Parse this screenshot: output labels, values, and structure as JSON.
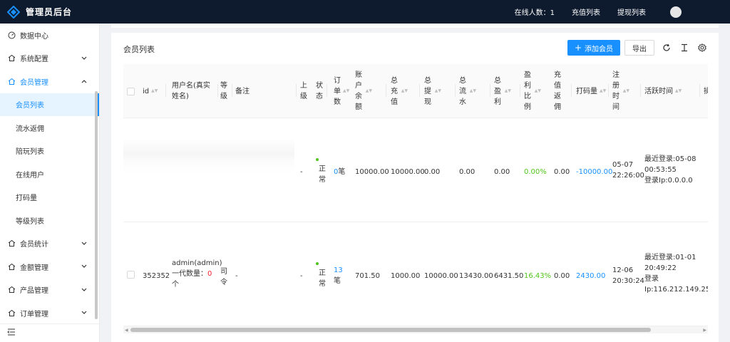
{
  "header": {
    "brand": "管理员后台",
    "online_count": "在线人数：1",
    "recharge_list": "充值列表",
    "withdraw_list": "提现列表"
  },
  "sidebar": {
    "items": [
      {
        "label": "数据中心",
        "icon": "dashboard-icon"
      },
      {
        "label": "系统配置",
        "icon": "home-icon"
      },
      {
        "label": "会员管理",
        "icon": "home-icon"
      },
      {
        "label": "会员列表"
      },
      {
        "label": "流水返佣"
      },
      {
        "label": "陪玩列表"
      },
      {
        "label": "在线用户"
      },
      {
        "label": "打码量"
      },
      {
        "label": "等级列表"
      },
      {
        "label": "会员统计",
        "icon": "home-icon"
      },
      {
        "label": "金额管理",
        "icon": "home-icon"
      },
      {
        "label": "产品管理",
        "icon": "home-icon"
      },
      {
        "label": "订单管理",
        "icon": "home-icon"
      }
    ]
  },
  "card": {
    "title": "会员列表",
    "add_button": "添加会员",
    "export_button": "导出"
  },
  "table": {
    "headers": {
      "id": "id",
      "username": "用户名(真实姓名)",
      "level": "等级",
      "remark": "备注",
      "superior": "上级",
      "status": "状态",
      "orders": "订单数",
      "balance": "账户余额",
      "total_recharge": "总充值",
      "total_withdraw": "总提现",
      "total_flow": "总流水",
      "total_profit": "总盈利",
      "profit_ratio": "盈利比例",
      "recharge_rebate": "充值返佣",
      "bet_amount": "打码量",
      "register_time": "注册时间",
      "active_time": "活跃时间",
      "more": "操"
    },
    "rows": [
      {
        "id": "",
        "username": "",
        "level": "",
        "remark": "",
        "superior": "-",
        "status": "正常",
        "orders_num": "0",
        "orders_unit": "笔",
        "balance": "10000.00",
        "total_recharge": "10000.00",
        "total_withdraw": "0.00",
        "total_flow": "0.00",
        "total_profit": "0.00",
        "profit_ratio": "0.00%",
        "recharge_rebate": "0.00",
        "bet_amount": "-10000.00",
        "register_date": "05-07",
        "register_time": "22:26:00",
        "active_line1": "最近登录:05-08",
        "active_line2": "00:53:55",
        "active_line3": "登录Ip:0.0.0.0"
      },
      {
        "id": "352352",
        "username_line1": "admin(admin)",
        "username_line2_prefix": "一代数量：",
        "username_line2_count": "0",
        "username_line3": "个",
        "level": "司令",
        "remark": "-",
        "superior": "-",
        "status": "正常",
        "orders_num": "13",
        "orders_unit": "笔",
        "balance": "701.50",
        "total_recharge": "1000.00",
        "total_withdraw": "10000.00",
        "total_flow": "13430.00",
        "total_profit": "6431.50",
        "profit_ratio": "16.43%",
        "recharge_rebate": "0.00",
        "bet_amount": "2430.00",
        "register_date": "12-06",
        "register_time": "20:30:24",
        "active_line1": "最近登录:01-01",
        "active_line2": "20:49:22",
        "active_line3": "登录",
        "active_line4": "Ip:116.212.149.25"
      }
    ]
  },
  "colors": {
    "primary": "#1890ff",
    "header_bg": "#0e1a2e",
    "success": "#52c41a",
    "danger": "#f5222d"
  }
}
